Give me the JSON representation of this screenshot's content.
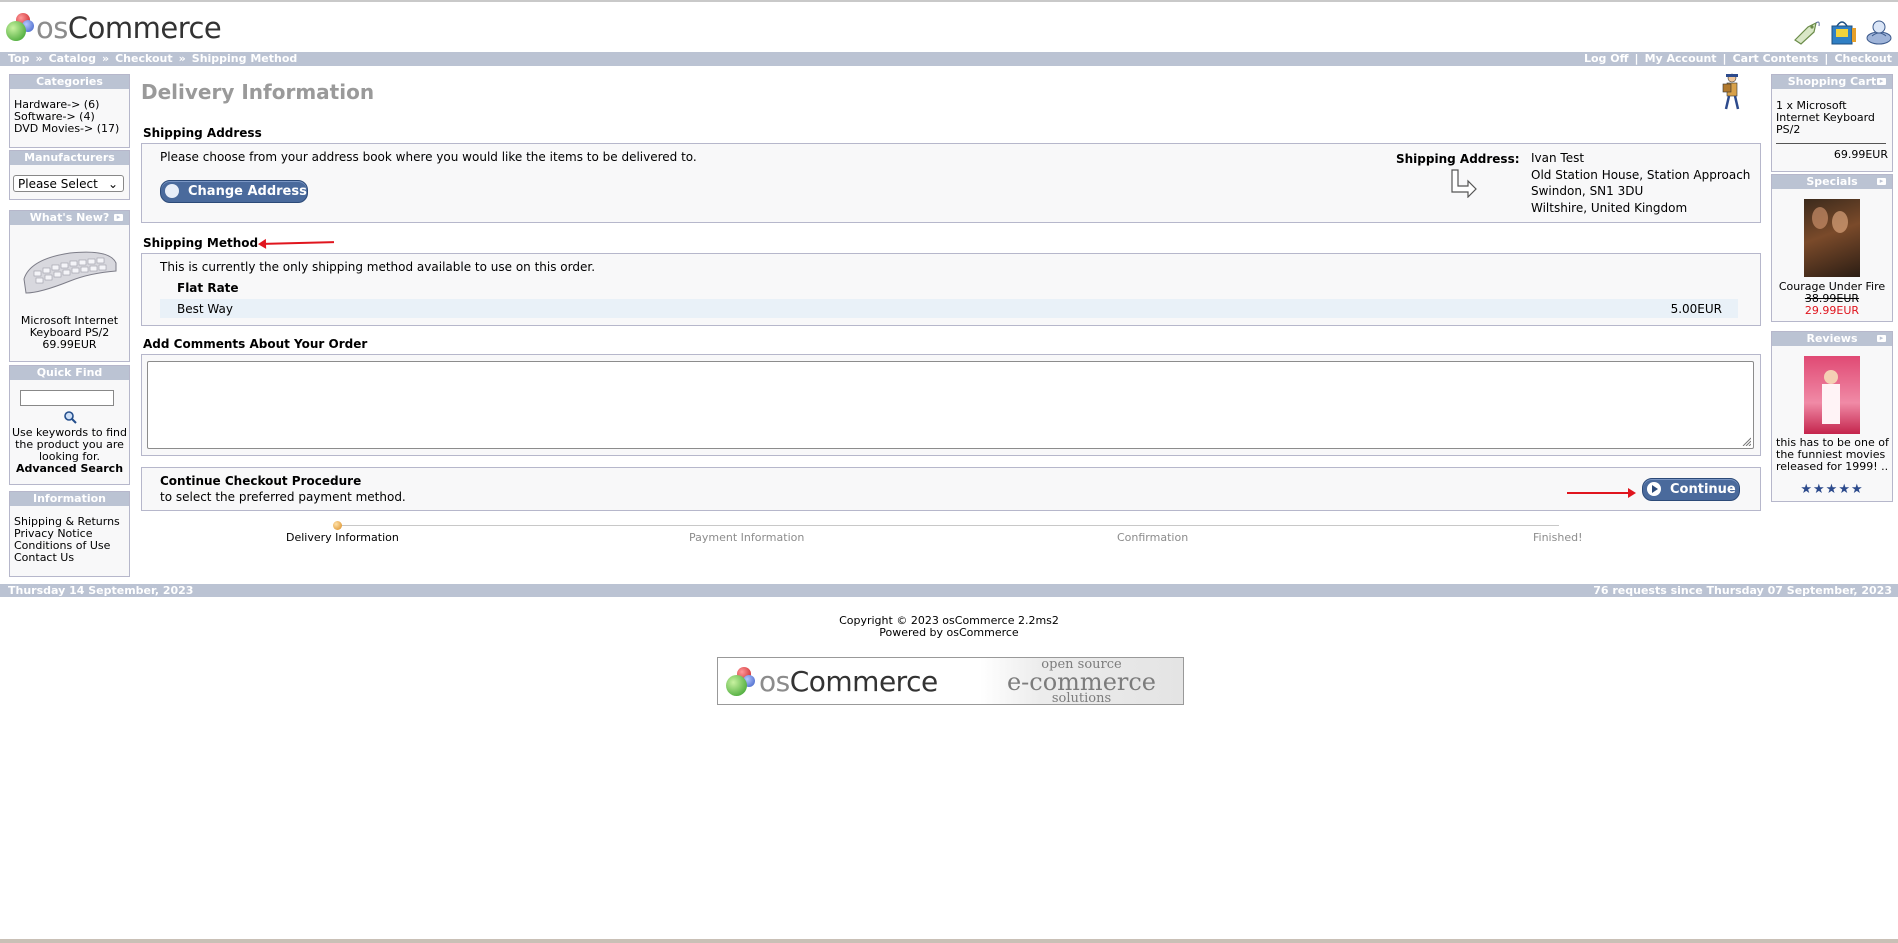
{
  "header": {
    "logo_os": "os",
    "logo_commerce": "Commerce",
    "icons": [
      "checkout-tag-icon",
      "shopping-bag-icon",
      "account-icon"
    ]
  },
  "navbar": {
    "crumbs": [
      "Top",
      "Catalog",
      "Checkout",
      "Shipping Method"
    ],
    "links": [
      "Log Off",
      "My Account",
      "Cart Contents",
      "Checkout"
    ]
  },
  "left": {
    "categories": {
      "title": "Categories",
      "items": [
        "Hardware-> (6)",
        "Software-> (4)",
        "DVD Movies-> (17)"
      ]
    },
    "manufacturers": {
      "title": "Manufacturers",
      "select": "Please Select"
    },
    "whats_new": {
      "title": "What's New?",
      "product": "Microsoft Internet Keyboard PS/2",
      "price": "69.99EUR"
    },
    "quick_find": {
      "title": "Quick Find",
      "text": "Use keywords to find the product you are looking for.",
      "link": "Advanced Search"
    },
    "information": {
      "title": "Information",
      "items": [
        "Shipping & Returns",
        "Privacy Notice",
        "Conditions of Use",
        "Contact Us"
      ]
    }
  },
  "main": {
    "title": "Delivery Information",
    "shipping_address": {
      "heading": "Shipping Address",
      "instruction": "Please choose from your address book where you would like the items to be delivered to.",
      "button": "Change Address",
      "label": "Shipping Address:",
      "lines": [
        "Ivan Test",
        "Old Station House, Station Approach",
        "Swindon, SN1 3DU",
        "Wiltshire, United Kingdom"
      ]
    },
    "shipping_method": {
      "heading": "Shipping Method",
      "note": "This is currently the only shipping method available to use on this order.",
      "method": "Flat Rate",
      "option": "Best Way",
      "price": "5.00EUR"
    },
    "comments": {
      "heading": "Add Comments About Your Order"
    },
    "continue": {
      "heading": "Continue Checkout Procedure",
      "sub": "to select the preferred payment method.",
      "button": "Continue"
    },
    "progress": [
      "Delivery Information",
      "Payment Information",
      "Confirmation",
      "Finished!"
    ]
  },
  "right": {
    "cart": {
      "title": "Shopping Cart",
      "item": "1 x Microsoft Internet Keyboard PS/2",
      "total": "69.99EUR"
    },
    "specials": {
      "title": "Specials",
      "product": "Courage Under Fire",
      "old_price": "38.99EUR",
      "new_price": "29.99EUR"
    },
    "reviews": {
      "title": "Reviews",
      "text": "this has to be one of the funniest movies released for 1999! ..",
      "stars": "★★★★★"
    }
  },
  "footer": {
    "date": "Thursday 14 September, 2023",
    "requests": "76 requests since Thursday 07 September, 2023",
    "copyright": "Copyright © 2023 osCommerce 2.2ms2",
    "powered": "Powered by osCommerce",
    "banner_os": "os",
    "banner_commerce": "Commerce",
    "banner_tag1": "open source",
    "banner_tag2": "e-commerce",
    "banner_tag3": "solutions"
  }
}
